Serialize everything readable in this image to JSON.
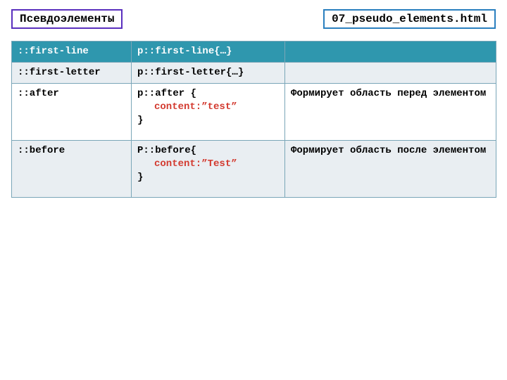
{
  "header": {
    "title": "Псевдоэлементы",
    "filename": "07_pseudo_elements.html"
  },
  "rows": [
    {
      "selector": "::first-line",
      "code_open": "p::first-line{…}",
      "code_red": "",
      "code_close": "",
      "desc": ""
    },
    {
      "selector": "::first-letter",
      "code_open": "p::first-letter{…}",
      "code_red": "",
      "code_close": "",
      "desc": ""
    },
    {
      "selector": "::after",
      "code_open": "p::after {",
      "code_red": "content:”test”",
      "code_close": "}",
      "desc": "Формирует область перед элементом"
    },
    {
      "selector": "::before",
      "code_open": "P::before{",
      "code_red": "content:”Test”",
      "code_close": "}",
      "desc": "Формирует область после элементом"
    }
  ]
}
